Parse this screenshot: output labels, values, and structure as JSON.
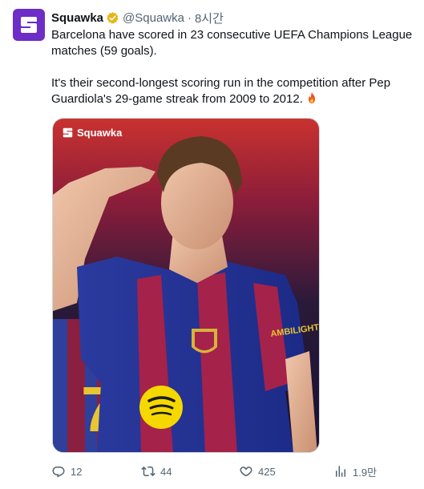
{
  "post": {
    "author_name": "Squawka",
    "handle": "@Squawka",
    "separator": "·",
    "time": "8시간",
    "text_line1": "Barcelona have scored in 23 consecutive UEFA Champions League matches (59 goals).",
    "text_line2": "It's their second-longest scoring run in the competition after Pep Guardiola's 29-game streak from 2009 to 2012.",
    "emoji": "fire-icon"
  },
  "media": {
    "watermark": "Squawka",
    "shirt_sponsor": "AMBILIGHT TV",
    "back_number": "7"
  },
  "actions": {
    "replies": "12",
    "reposts": "44",
    "likes": "425",
    "views": "1.9만"
  },
  "colors": {
    "brand_purple": "#6d2dc7",
    "verified_gold": "#e2b719",
    "muted_text": "#536471"
  }
}
